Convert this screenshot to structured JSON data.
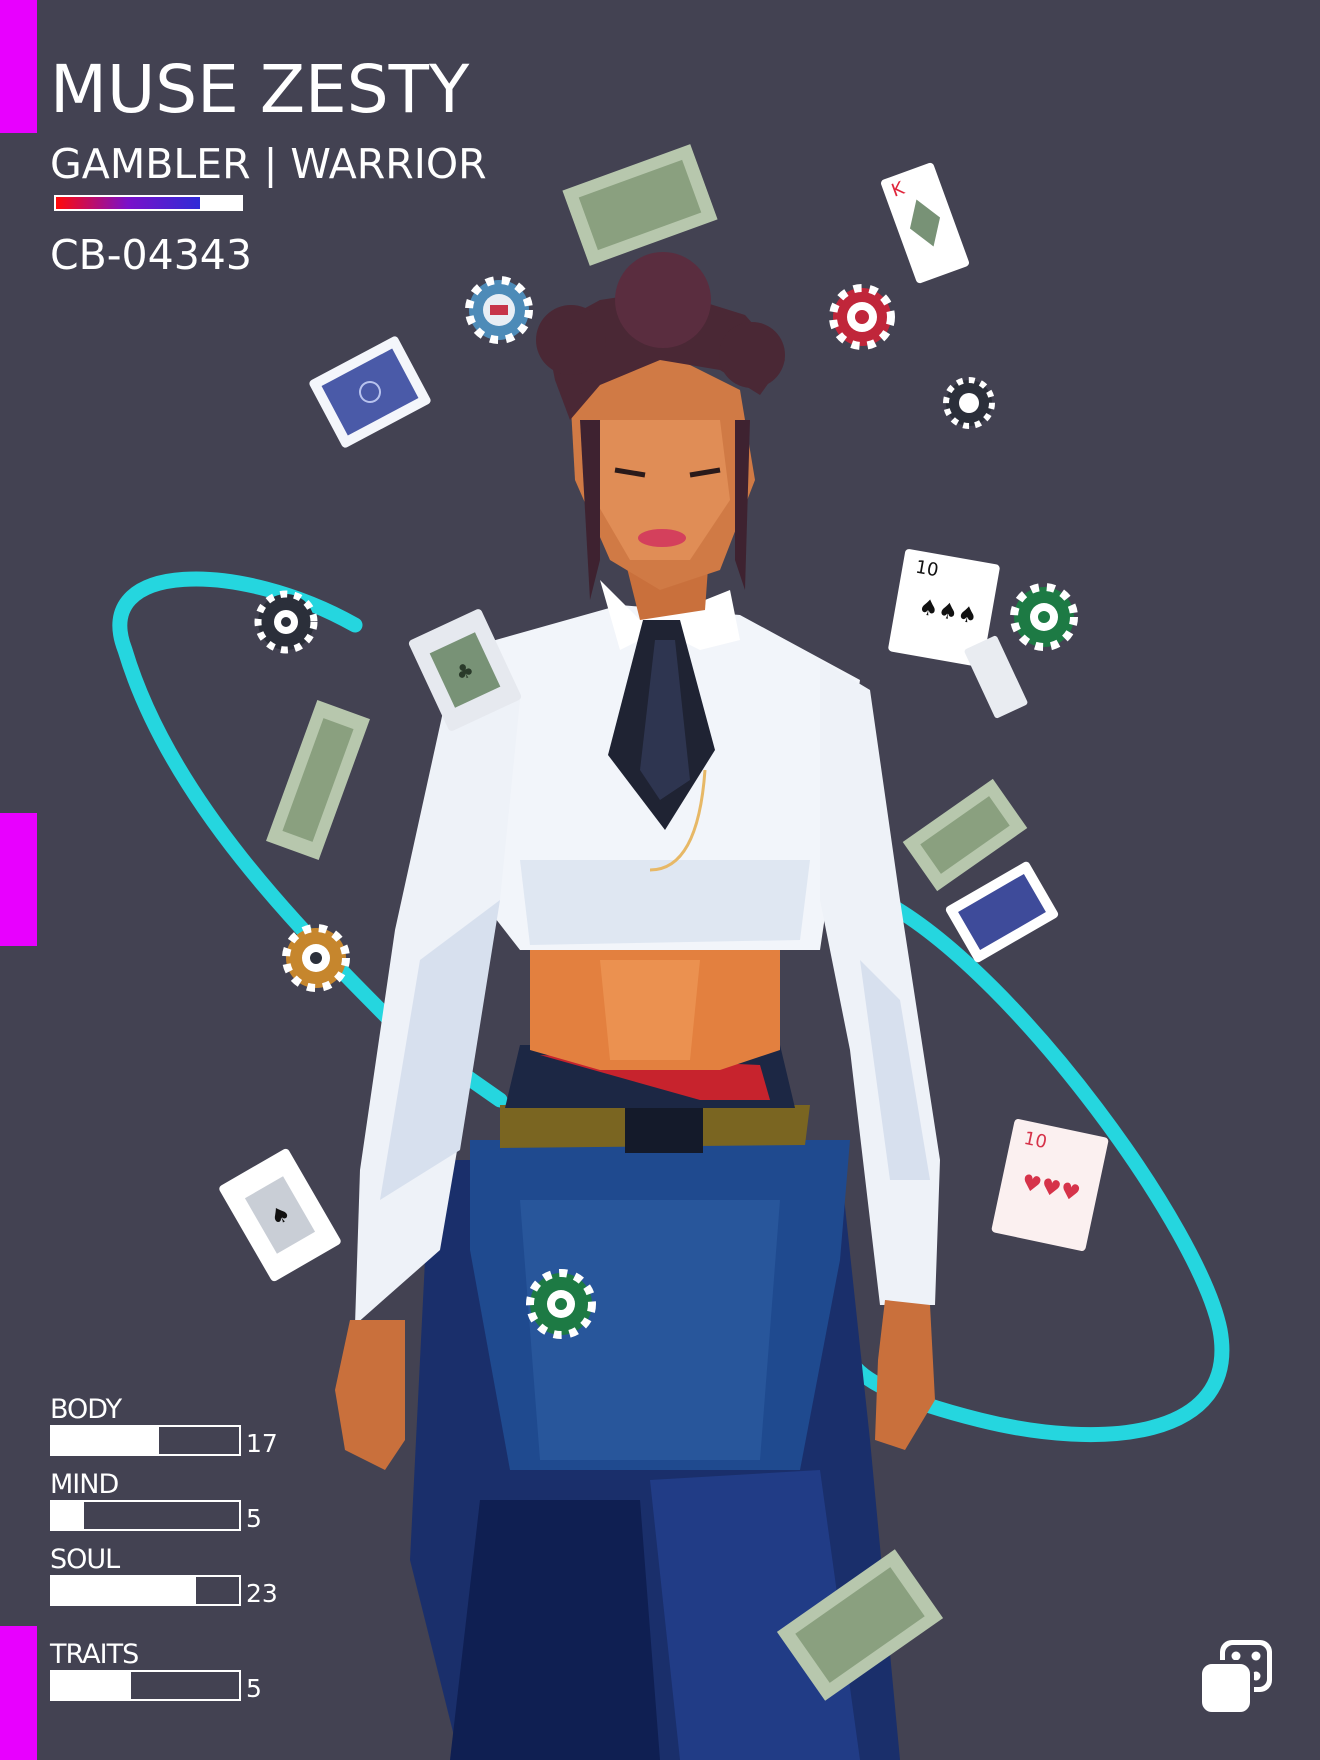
{
  "character": {
    "name": "MUSE ZESTY",
    "classes": "GAMBLER | WARRIOR",
    "class_bar_fraction": 0.78,
    "card_id": "CB-04343"
  },
  "stats": [
    {
      "label": "BODY",
      "value": "17",
      "fraction": 0.57
    },
    {
      "label": "MIND",
      "value": "5",
      "fraction": 0.17
    },
    {
      "label": "SOUL",
      "value": "23",
      "fraction": 0.77
    },
    {
      "label": "TRAITS",
      "value": "5",
      "fraction": 0.42
    }
  ],
  "colors": {
    "background": "#434252",
    "accent": "#e800ff",
    "ring": "#25d6df",
    "class_bar_gradient": [
      "#ff0a0a",
      "#7a11c9",
      "#2f2bd6"
    ]
  },
  "icons": {
    "logo": "dice-icon"
  }
}
